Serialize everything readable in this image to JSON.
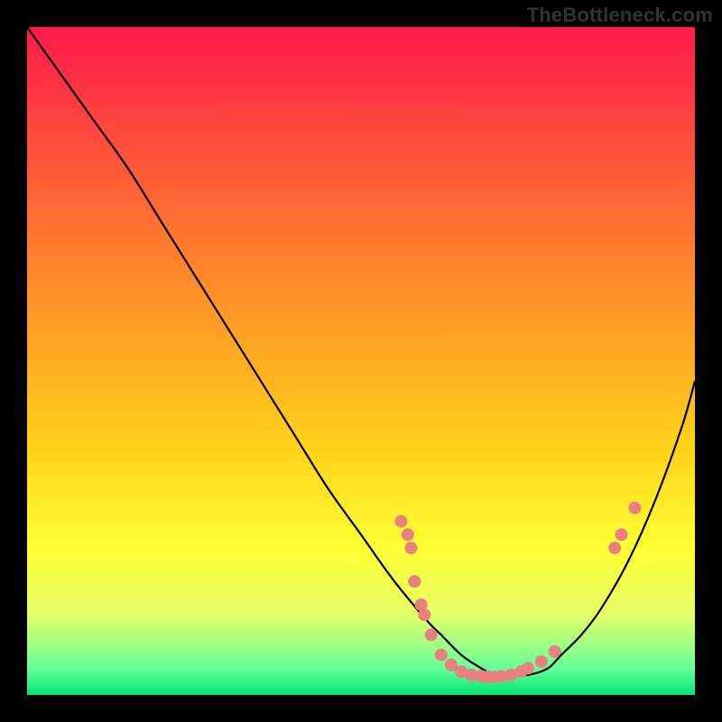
{
  "watermark": "TheBottleneck.com",
  "chart_data": {
    "type": "line",
    "title": "",
    "xlabel": "",
    "ylabel": "",
    "xlim": [
      0,
      100
    ],
    "ylim": [
      0,
      100
    ],
    "grid": false,
    "legend": false,
    "background_gradient": {
      "stops": [
        {
          "offset": 0.0,
          "color": "#ff1a4b"
        },
        {
          "offset": 0.38,
          "color": "#ff8a2a"
        },
        {
          "offset": 0.63,
          "color": "#ffd21a"
        },
        {
          "offset": 0.78,
          "color": "#ffff33"
        },
        {
          "offset": 0.88,
          "color": "#e6ff66"
        },
        {
          "offset": 0.96,
          "color": "#66ff99"
        },
        {
          "offset": 1.0,
          "color": "#00e676"
        }
      ]
    },
    "series": [
      {
        "name": "bottleneck-curve",
        "color": "#000000",
        "x": [
          0,
          5,
          10,
          15,
          20,
          25,
          30,
          35,
          40,
          45,
          50,
          55,
          60,
          62,
          65,
          68,
          70,
          72,
          75,
          78,
          80,
          83,
          86,
          90,
          94,
          98,
          100
        ],
        "y": [
          100,
          93,
          86,
          79,
          71,
          63,
          55,
          47,
          39,
          31,
          24,
          17,
          11,
          9,
          6,
          4,
          3,
          3,
          3,
          4,
          6,
          9,
          13,
          20,
          29,
          40,
          47
        ]
      }
    ],
    "scatter": {
      "name": "highlighted-points",
      "color": "#e98080",
      "radius": 7,
      "points": [
        {
          "x": 56,
          "y": 26
        },
        {
          "x": 57,
          "y": 24
        },
        {
          "x": 57.5,
          "y": 22
        },
        {
          "x": 58,
          "y": 17
        },
        {
          "x": 59,
          "y": 13.5
        },
        {
          "x": 59.5,
          "y": 12
        },
        {
          "x": 60.5,
          "y": 9
        },
        {
          "x": 62,
          "y": 6
        },
        {
          "x": 63.5,
          "y": 4.5
        },
        {
          "x": 65,
          "y": 3.5
        },
        {
          "x": 66.5,
          "y": 3
        },
        {
          "x": 68,
          "y": 2.8
        },
        {
          "x": 69,
          "y": 2.7
        },
        {
          "x": 70,
          "y": 2.7
        },
        {
          "x": 71,
          "y": 2.8
        },
        {
          "x": 72.5,
          "y": 3
        },
        {
          "x": 74,
          "y": 3.5
        },
        {
          "x": 75,
          "y": 4
        },
        {
          "x": 77,
          "y": 5
        },
        {
          "x": 79,
          "y": 6.5
        },
        {
          "x": 88,
          "y": 22
        },
        {
          "x": 89,
          "y": 24
        },
        {
          "x": 91,
          "y": 28
        }
      ]
    }
  }
}
